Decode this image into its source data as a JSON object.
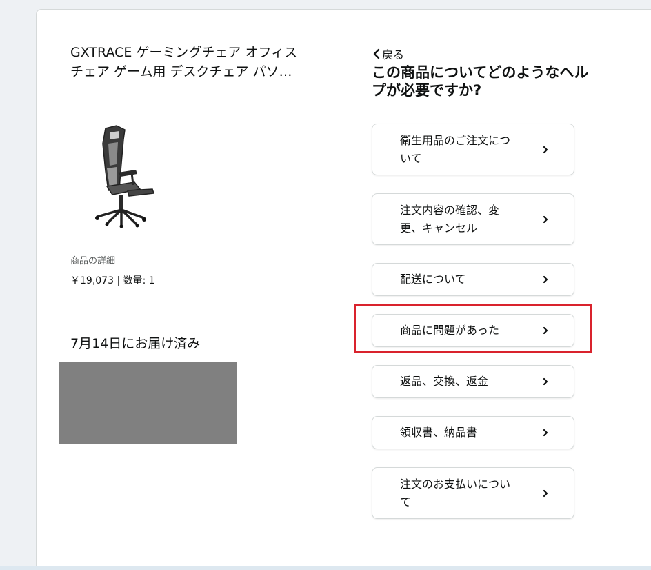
{
  "product": {
    "title_line1": "GXTRACE ゲーミングチェア オフィス",
    "title_line2": "チェア ゲーム用 デスクチェア パソ…",
    "image_icon": "gaming-chair-image",
    "details_label": "商品の詳細",
    "price": "￥19,073",
    "separator": "|",
    "quantity_label": "数量:",
    "quantity": "1"
  },
  "delivery": {
    "status": "7月14日にお届け済み"
  },
  "help": {
    "back_label": "戻る",
    "heading_line1": "この商品についてどのようなヘル",
    "heading_line2": "プが必要ですか?",
    "options": [
      {
        "line1": "衛生用品のご注文につ",
        "line2": "いて"
      },
      {
        "line1": "注文内容の確認、変",
        "line2": "更、キャンセル"
      },
      {
        "line1": "配送について",
        "line2": ""
      },
      {
        "line1": "商品に問題があった",
        "line2": ""
      },
      {
        "line1": "返品、交換、返金",
        "line2": ""
      },
      {
        "line1": "領収書、納品書",
        "line2": ""
      },
      {
        "line1": "注文のお支払いについ",
        "line2": "て"
      }
    ]
  },
  "colors": {
    "highlight": "#d9232d",
    "redacted": "#808080",
    "text": "#0f1111",
    "muted_text": "#565959",
    "border": "#d5d9d9"
  }
}
